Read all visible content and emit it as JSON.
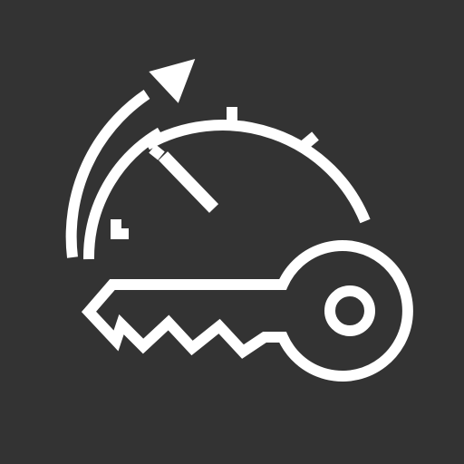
{
  "icon": {
    "name": "key-rotation-timer-icon",
    "description_label": "",
    "colors": {
      "background": "#333333",
      "stroke": "#ffffff"
    },
    "parts": [
      "timer-dial",
      "rotation-arrow",
      "key"
    ]
  }
}
